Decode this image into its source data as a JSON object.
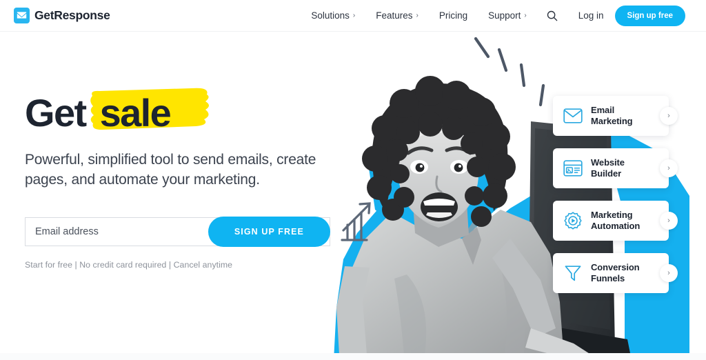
{
  "brand": {
    "blue": "#0fb4f2",
    "logo_blue": "#29b6f0",
    "yellow": "#ffe500",
    "dark": "#1d2430"
  },
  "header": {
    "logo_text": "GetResponse",
    "logo_icon": "envelope-icon",
    "nav": [
      {
        "label": "Solutions",
        "caret": "›",
        "has_caret": true
      },
      {
        "label": "Features",
        "caret": "›",
        "has_caret": true
      },
      {
        "label": "Pricing",
        "caret": "",
        "has_caret": false
      },
      {
        "label": "Support",
        "caret": "›",
        "has_caret": true
      }
    ],
    "search_icon": "search-icon",
    "login_label": "Log in",
    "signup_label": "Sign up free"
  },
  "hero": {
    "headline_plain": "Get",
    "headline_accent": "sale",
    "subheading": "Powerful, simplified tool to send emails, create pages, and automate your marketing.",
    "form": {
      "email_placeholder": "Email address",
      "email_value": "",
      "submit_label": "SIGN UP FREE"
    },
    "disclaimer": "Start for free | No credit card required | Cancel anytime"
  },
  "cards": [
    {
      "icon": "envelope-outline-icon",
      "line1": "Email",
      "line2": "Marketing",
      "chevron": "›"
    },
    {
      "icon": "website-builder-icon",
      "line1": "Website",
      "line2": "Builder",
      "chevron": "›"
    },
    {
      "icon": "gear-play-icon",
      "line1": "Marketing",
      "line2": "Automation",
      "chevron": "›"
    },
    {
      "icon": "funnel-icon",
      "line1": "Conversion",
      "line2": "Funnels",
      "chevron": "›"
    }
  ],
  "collage": {
    "photo_alt": "excited-woman-holding-laptop",
    "doodles": [
      "growth-chart-doodle",
      "excitement-dashes-doodle"
    ]
  }
}
